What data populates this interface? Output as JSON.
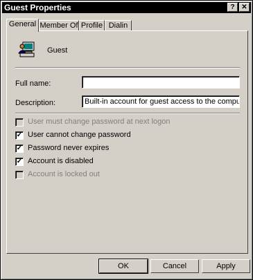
{
  "window": {
    "title": "Guest Properties"
  },
  "titlebar": {
    "help_glyph": "?",
    "close_glyph": "✕"
  },
  "tabs": [
    {
      "label": "General"
    },
    {
      "label": "Member Of"
    },
    {
      "label": "Profile"
    },
    {
      "label": "Dialin"
    }
  ],
  "user": {
    "name": "Guest",
    "icon": "user-computer-icon"
  },
  "form": {
    "fullname_label": "Full name:",
    "fullname_value": "",
    "description_label": "Description:",
    "description_value": "Built-in account for guest access to the computer/do"
  },
  "checkboxes": [
    {
      "label": "User must change password at next logon",
      "checked": false,
      "enabled": false
    },
    {
      "label": "User cannot change password",
      "checked": true,
      "enabled": true
    },
    {
      "label": "Password never expires",
      "checked": true,
      "enabled": true
    },
    {
      "label": "Account is disabled",
      "checked": true,
      "enabled": true
    },
    {
      "label": "Account is locked out",
      "checked": false,
      "enabled": false
    }
  ],
  "buttons": {
    "ok": "OK",
    "cancel": "Cancel",
    "apply": "Apply"
  }
}
